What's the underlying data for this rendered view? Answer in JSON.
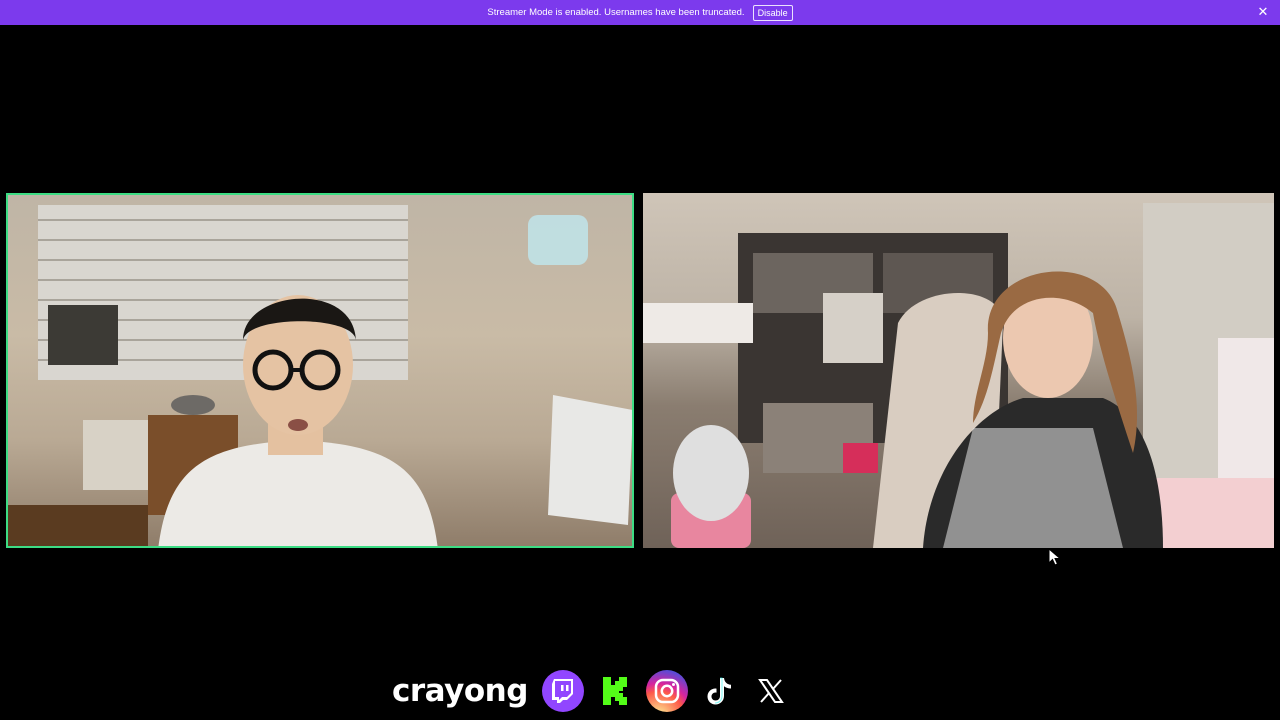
{
  "banner": {
    "message": "Streamer Mode is enabled. Usernames have been truncated.",
    "disable_label": "Disable",
    "color": "#7c3aed"
  },
  "videos": {
    "left": {
      "participant": "male participant with glasses",
      "speaking": true,
      "border_color": "#3ddc84"
    },
    "right": {
      "participant": "female participant",
      "speaking": false
    }
  },
  "overlay": {
    "brand_name": "crayong",
    "social_icons": [
      "twitch-icon",
      "kick-icon",
      "instagram-icon",
      "tiktok-icon",
      "x-icon"
    ]
  }
}
